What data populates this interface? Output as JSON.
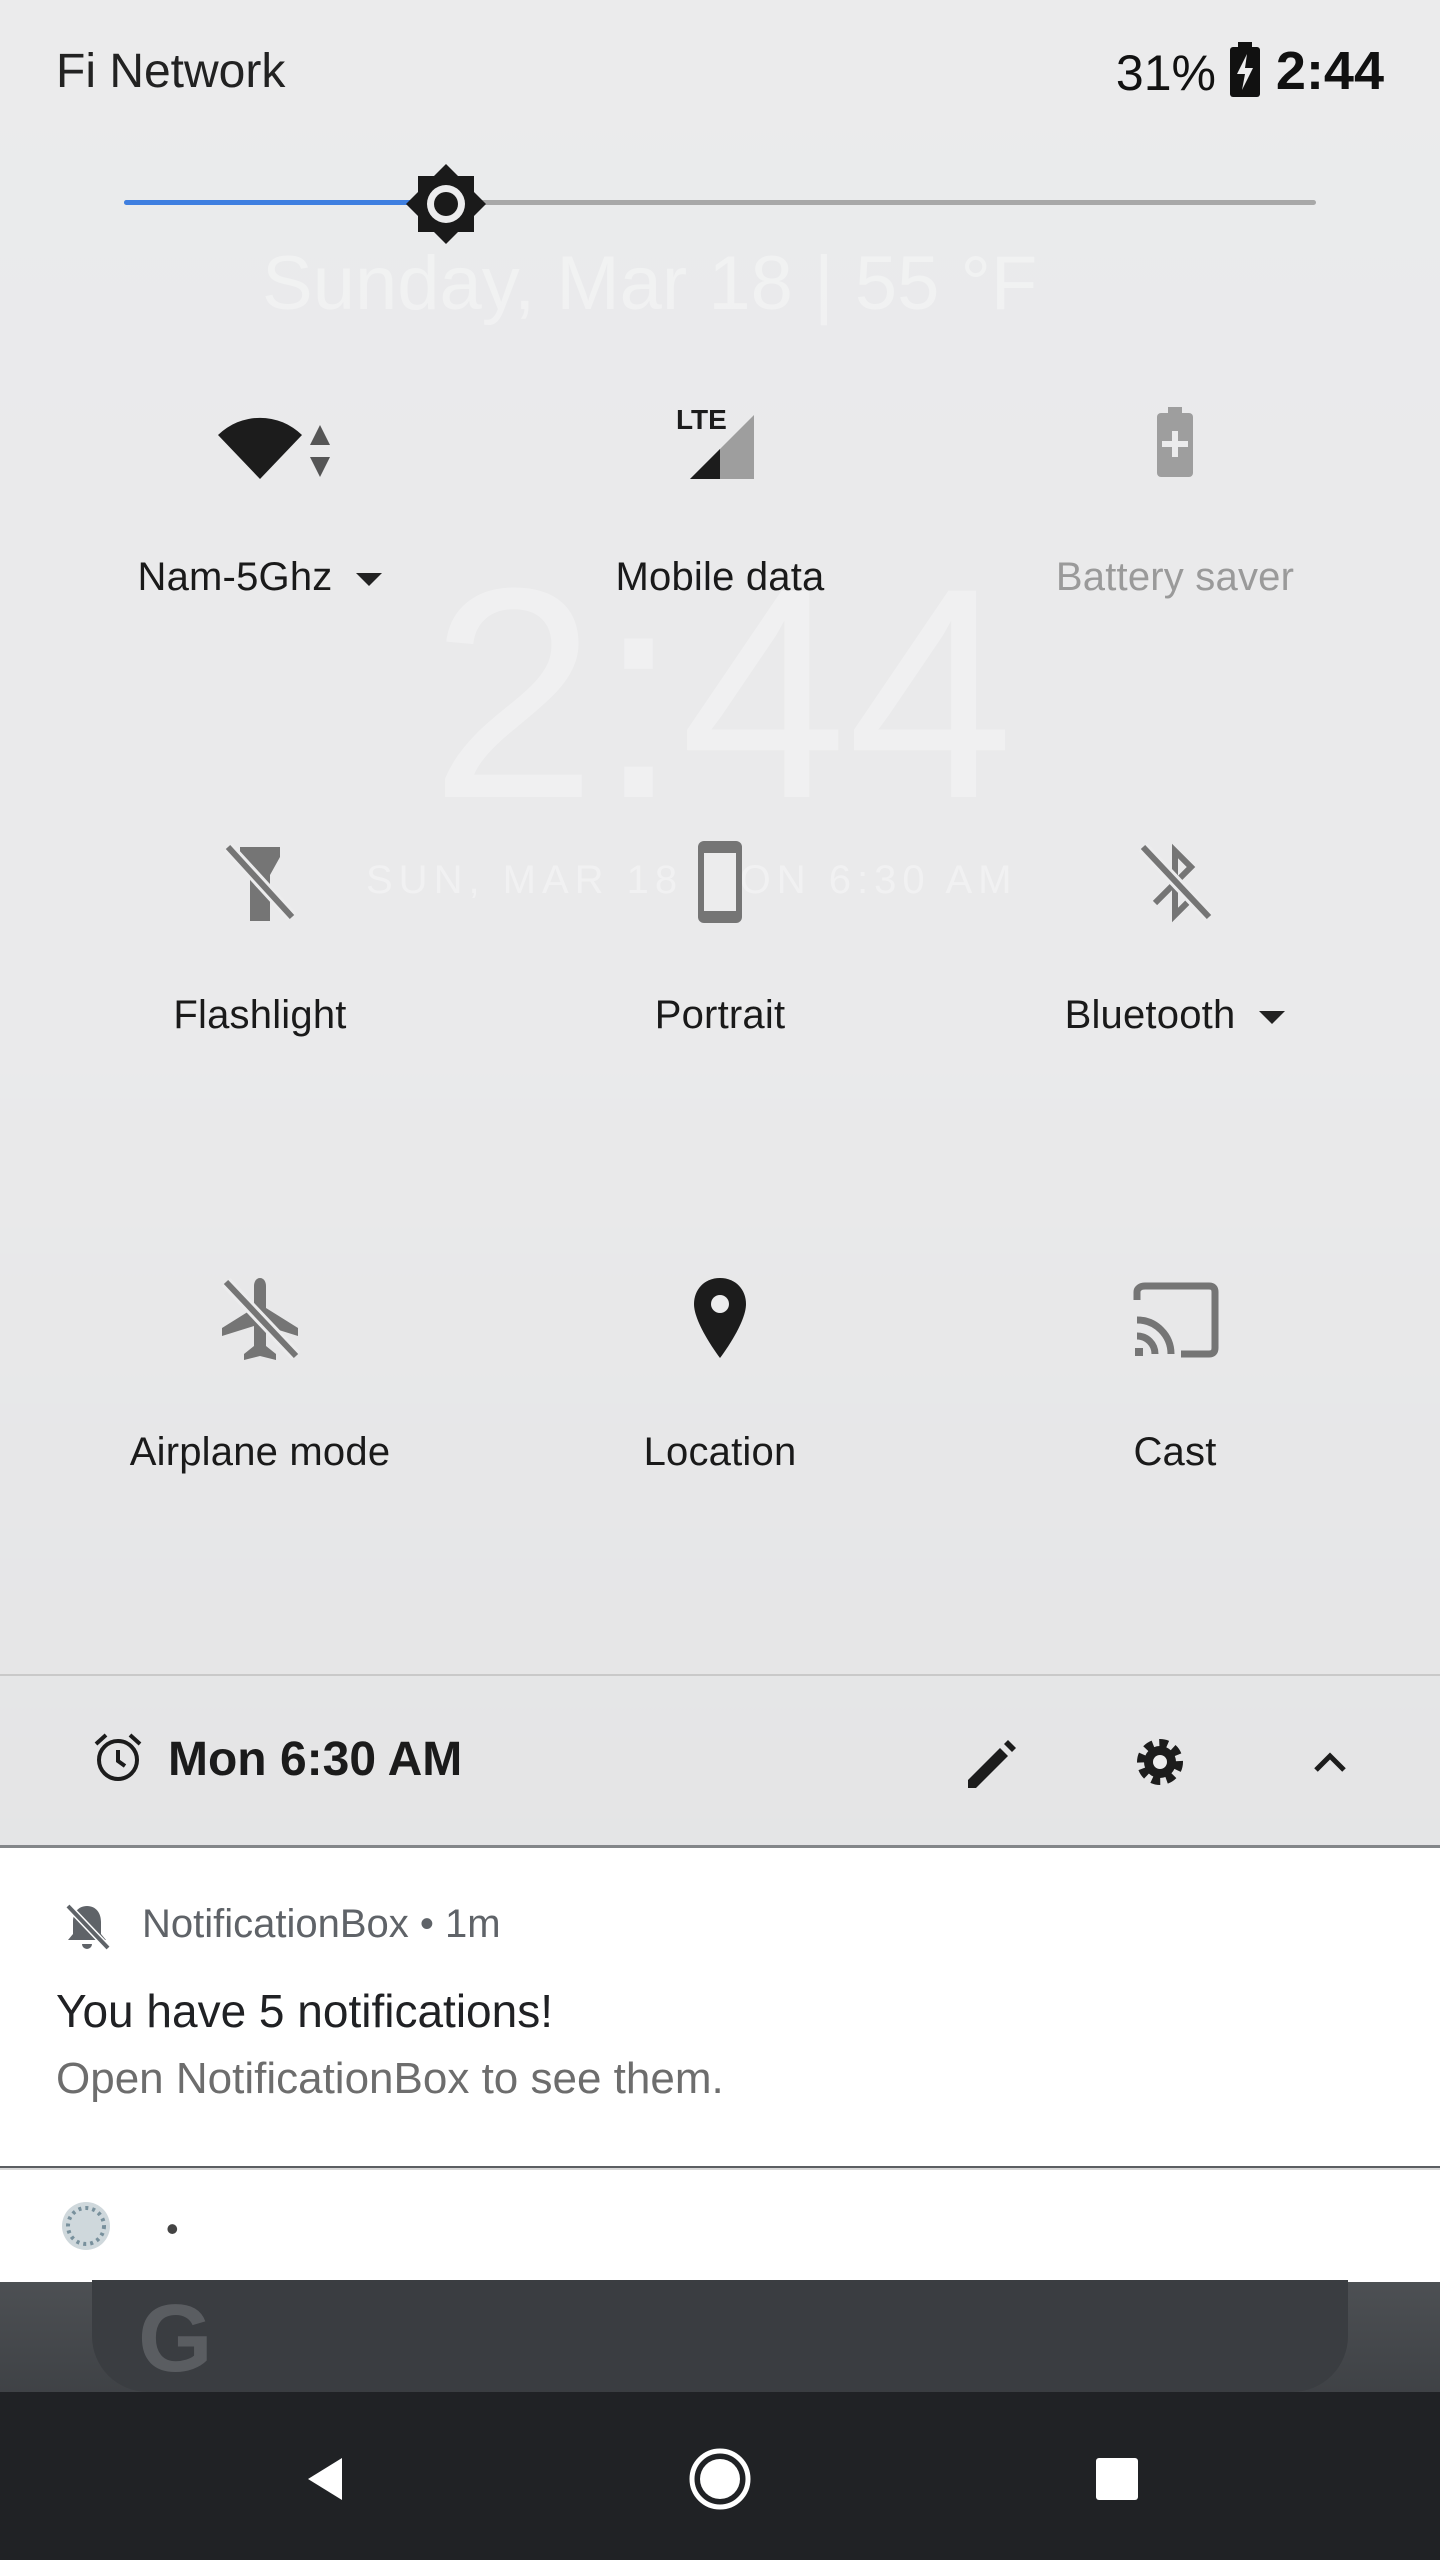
{
  "status_bar": {
    "carrier": "Fi Network",
    "battery_percent": "31%",
    "time": "2:44"
  },
  "brightness": {
    "level": 0.27
  },
  "background": {
    "date_weather": "Sunday, Mar 18  |  55 °F",
    "big_clock": "2:44",
    "lock_line": "SUN, MAR 18   MON 6:30 AM"
  },
  "tiles": [
    {
      "label": "Nam-5Ghz",
      "icon": "wifi-icon",
      "active": true,
      "has_dropdown": true
    },
    {
      "label": "Mobile data",
      "icon": "lte-signal-icon",
      "active": true,
      "has_dropdown": false
    },
    {
      "label": "Battery saver",
      "icon": "battery-saver-icon",
      "active": false,
      "has_dropdown": false
    },
    {
      "label": "Flashlight",
      "icon": "flashlight-off-icon",
      "active": true,
      "has_dropdown": false
    },
    {
      "label": "Portrait",
      "icon": "portrait-icon",
      "active": true,
      "has_dropdown": false
    },
    {
      "label": "Bluetooth",
      "icon": "bluetooth-off-icon",
      "active": true,
      "has_dropdown": true
    },
    {
      "label": "Airplane mode",
      "icon": "airplane-off-icon",
      "active": true,
      "has_dropdown": false
    },
    {
      "label": "Location",
      "icon": "location-icon",
      "active": true,
      "has_dropdown": false
    },
    {
      "label": "Cast",
      "icon": "cast-icon",
      "active": true,
      "has_dropdown": false
    }
  ],
  "alarm": {
    "text": "Mon 6:30 AM"
  },
  "notification": {
    "app": "NotificationBox • 1m",
    "title": "You have 5 notifications!",
    "body": "Open NotificationBox to see them."
  },
  "notification2": {
    "text": "•"
  },
  "colors": {
    "accent": "#3f7fe0",
    "shade": "#ececed",
    "navbar": "#202225"
  }
}
